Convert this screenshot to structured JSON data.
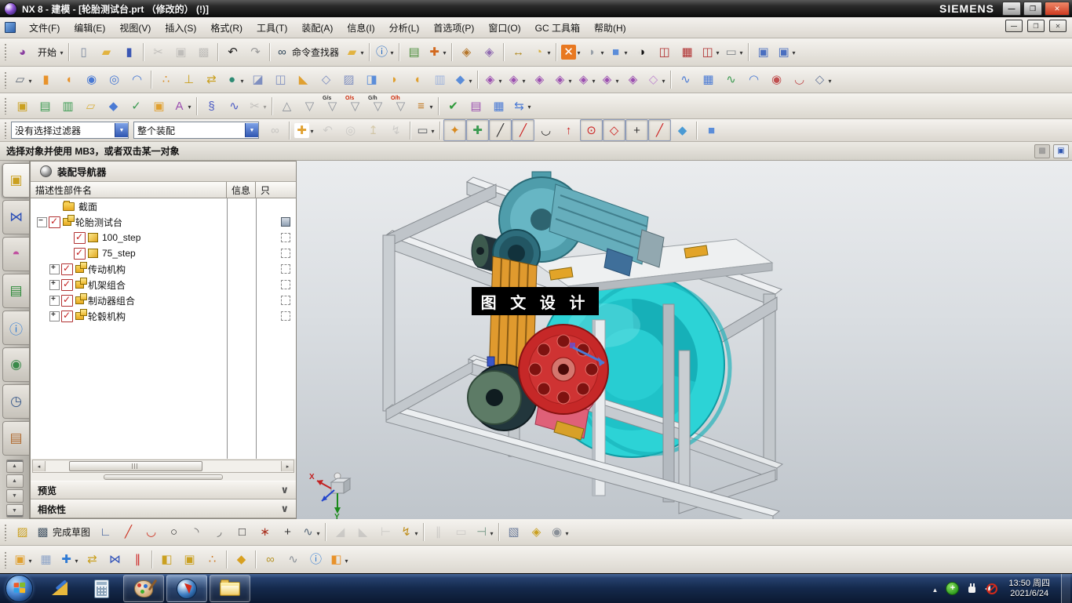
{
  "window": {
    "title": "NX 8 - 建模 - [轮胎测试台.prt （修改的）  (!)]",
    "brand": "SIEMENS"
  },
  "colors": {
    "taskbar_blue": "#15284d",
    "tire_cyan": "#2cd3d6",
    "disc_red": "#c62828",
    "belt_orange": "#e09a2e",
    "motor_teal": "#5fa8ba",
    "frame_gray": "#c9ced2",
    "watermark_bg": "#000000",
    "check_red": "#c41f1f"
  },
  "menu": {
    "items": [
      {
        "n": "menu-file",
        "label": "文件(F)"
      },
      {
        "n": "menu-edit",
        "label": "编辑(E)"
      },
      {
        "n": "menu-view",
        "label": "视图(V)"
      },
      {
        "n": "menu-insert",
        "label": "插入(S)"
      },
      {
        "n": "menu-format",
        "label": "格式(R)"
      },
      {
        "n": "menu-tools",
        "label": "工具(T)"
      },
      {
        "n": "menu-assemblies",
        "label": "装配(A)"
      },
      {
        "n": "menu-information",
        "label": "信息(I)"
      },
      {
        "n": "menu-analysis",
        "label": "分析(L)"
      },
      {
        "n": "menu-preferences",
        "label": "首选项(P)"
      },
      {
        "n": "menu-window",
        "label": "窗口(O)"
      },
      {
        "n": "menu-gc-toolbox",
        "label": "GC 工具箱"
      },
      {
        "n": "menu-help",
        "label": "帮助(H)"
      }
    ]
  },
  "toolbars": {
    "row1": [
      {
        "n": "nx-logo-icon",
        "g": "◕",
        "c": "#8a3fa0"
      },
      {
        "n": "start-menu-button",
        "label": "开始",
        "dd": 1
      },
      {
        "sep": 1
      },
      {
        "n": "new-file-button",
        "g": "▯",
        "c": "#7d8aa0"
      },
      {
        "n": "open-file-button",
        "g": "▰",
        "c": "#e2b340"
      },
      {
        "n": "save-button",
        "g": "▮",
        "c": "#3b57b4"
      },
      {
        "sep": 1
      },
      {
        "n": "cut-button",
        "g": "✂",
        "c": "#8a8a8a",
        "dis": 1
      },
      {
        "n": "copy-button",
        "g": "▣",
        "c": "#8a8a8a",
        "dis": 1
      },
      {
        "n": "paste-button",
        "g": "▩",
        "c": "#8a8a8a",
        "dis": 1
      },
      {
        "sep": 1
      },
      {
        "n": "undo-button",
        "g": "↶",
        "c": "#1c1c1c"
      },
      {
        "n": "redo-button",
        "g": "↷",
        "c": "#9a9a9a"
      },
      {
        "sep": 1
      },
      {
        "n": "command-finder-button",
        "g": "∞",
        "c": "#30475a",
        "label": "命令查找器"
      },
      {
        "n": "recent-files-button",
        "g": "▰",
        "c": "#e2b340",
        "dd": 1
      },
      {
        "sep": 1
      },
      {
        "n": "help-info-button",
        "g": "ⓘ",
        "c": "#1f66c0",
        "dd": 1
      },
      {
        "sep": 1
      },
      {
        "n": "object-info-button",
        "g": "▤",
        "c": "#4d8f3c"
      },
      {
        "n": "wcs-dynamics-button",
        "g": "✚",
        "c": "#d2691e",
        "dd": 1
      },
      {
        "sep": 1
      },
      {
        "n": "snapshot-button",
        "g": "◈",
        "c": "#b5762a"
      },
      {
        "n": "role-button",
        "g": "◈",
        "c": "#8f6ab0"
      },
      {
        "sep": 1
      },
      {
        "n": "measure-distance-button",
        "g": "↔",
        "c": "#b08a20"
      },
      {
        "n": "measure-angle-button",
        "g": "◔",
        "c": "#d8b040",
        "dd": 1
      },
      {
        "sep": 1
      },
      {
        "n": "close-window-button",
        "g": "✕",
        "c": "#ffffff",
        "b": "#e87820",
        "dd": 1
      },
      {
        "n": "display-part-button",
        "g": "◗",
        "c": "#98a0a8",
        "dd": 1
      },
      {
        "n": "shaded-display-button",
        "g": "■",
        "c": "#5b8dd9",
        "dd": 1
      },
      {
        "n": "render-style-button",
        "g": "◑",
        "c": "#111111"
      },
      {
        "n": "fix-display-1-button",
        "g": "◫",
        "c": "#b03030"
      },
      {
        "n": "fix-display-2-button",
        "g": "▦",
        "c": "#b03030"
      },
      {
        "n": "fix-display-3-button",
        "g": "◫",
        "c": "#b03030",
        "dd": 1
      },
      {
        "n": "background-color-button",
        "g": "▭",
        "c": "#80858a",
        "dd": 1
      },
      {
        "sep": 1
      },
      {
        "n": "window-cascade-button",
        "g": "▣",
        "c": "#4a6fc0"
      },
      {
        "n": "window-split-button",
        "g": "▣",
        "c": "#4a6fc0",
        "dd": 1
      }
    ],
    "row2": [
      {
        "n": "sketch-button",
        "g": "▱",
        "c": "#606a78",
        "dd": 1
      },
      {
        "n": "extrude-button",
        "g": "▮",
        "c": "#e8922a"
      },
      {
        "n": "revolve-button",
        "g": "◖",
        "c": "#e8922a"
      },
      {
        "n": "hole-button",
        "g": "◉",
        "c": "#4a7ad4"
      },
      {
        "n": "boss-button",
        "g": "◎",
        "c": "#4a7ad4"
      },
      {
        "n": "draft-button",
        "g": "◠",
        "c": "#4a7ad4"
      },
      {
        "sep": 1
      },
      {
        "n": "pattern-feature-button",
        "g": "∴",
        "c": "#d88a20"
      },
      {
        "n": "datum-plane-button",
        "g": "⊥",
        "c": "#caa020"
      },
      {
        "n": "move-object-button",
        "g": "⇄",
        "c": "#caa020"
      },
      {
        "n": "unite-button",
        "g": "●",
        "c": "#2e8b74",
        "dd": 1
      },
      {
        "n": "trim-body-button",
        "g": "◪",
        "c": "#7f8fc0"
      },
      {
        "n": "split-body-button",
        "g": "◫",
        "c": "#7f8fc0"
      },
      {
        "n": "bend-button",
        "g": "◣",
        "c": "#e0a030"
      },
      {
        "n": "sew-button",
        "g": "◇",
        "c": "#7f8fc0"
      },
      {
        "n": "patch-button",
        "g": "▨",
        "c": "#7f8fc0"
      },
      {
        "n": "offset-face-button",
        "g": "◨",
        "c": "#5b8dd9"
      },
      {
        "n": "flange-button",
        "g": "◗",
        "c": "#e0a030"
      },
      {
        "n": "contour-flange-button",
        "g": "◖",
        "c": "#e0a030"
      },
      {
        "n": "sheet-body-button",
        "g": "▥",
        "c": "#9fb4dc"
      },
      {
        "n": "polyhedron-button",
        "g": "◆",
        "c": "#5b8dd9",
        "dd": 1
      },
      {
        "sep": 1
      },
      {
        "n": "sm-move-face-button",
        "g": "◈",
        "c": "#9b4fb0",
        "dd": 1
      },
      {
        "n": "sm-pull-face-button",
        "g": "◈",
        "c": "#9b4fb0",
        "dd": 1
      },
      {
        "n": "sm-delete-face-button",
        "g": "◈",
        "c": "#9b4fb0"
      },
      {
        "n": "sm-copy-face-button",
        "g": "◈",
        "c": "#9b4fb0",
        "dd": 1
      },
      {
        "n": "sm-shell-button",
        "g": "◈",
        "c": "#9b4fb0",
        "dd": 1
      },
      {
        "n": "sm-resize-face-button",
        "g": "◈",
        "c": "#9b4fb0",
        "dd": 1
      },
      {
        "n": "sm-pattern-face-button",
        "g": "◈",
        "c": "#9b4fb0"
      },
      {
        "n": "sm-edge-blend-button",
        "g": "◇",
        "c": "#c08ad0",
        "dd": 1
      },
      {
        "sep": 1
      },
      {
        "n": "through-curves-button",
        "g": "∿",
        "c": "#4a7ad4"
      },
      {
        "n": "curve-mesh-button",
        "g": "▦",
        "c": "#4a7ad4"
      },
      {
        "n": "studio-surface-button",
        "g": "∿",
        "c": "#3a9a50"
      },
      {
        "n": "swept-button",
        "g": "◠",
        "c": "#4a7ad4"
      },
      {
        "n": "n-sided-surface-button",
        "g": "◉",
        "c": "#c05050"
      },
      {
        "n": "bridge-surface-button",
        "g": "◡",
        "c": "#c05050"
      },
      {
        "n": "more-surface-button",
        "g": "◇",
        "c": "#6a7a9a",
        "dd": 1
      }
    ],
    "row3": [
      {
        "n": "task-sketch-button",
        "g": "▣",
        "c": "#caa020"
      },
      {
        "n": "layer-settings-button",
        "g": "▤",
        "c": "#3a9a50"
      },
      {
        "n": "view-in-layer-button",
        "g": "▥",
        "c": "#3a9a50"
      },
      {
        "n": "annotation-button",
        "g": "▱",
        "c": "#d8b040"
      },
      {
        "n": "interference-check-button",
        "g": "◆",
        "c": "#4a7ad4"
      },
      {
        "n": "clamp-check-button",
        "g": "✓",
        "c": "#3a9a50"
      },
      {
        "n": "export-check-button",
        "g": "▣",
        "c": "#e0a030"
      },
      {
        "n": "text-button",
        "g": "A",
        "c": "#9b4fb0",
        "dd": 1
      },
      {
        "sep": 1
      },
      {
        "n": "spring-design-button",
        "g": "§",
        "c": "#4a5ac4"
      },
      {
        "n": "spring-stretch-button",
        "g": "∿",
        "c": "#4a5ac4"
      },
      {
        "n": "spring-cut-button",
        "g": "✂",
        "c": "#8a8a8a",
        "dis": 1,
        "dd": 1
      },
      {
        "sep": 1
      },
      {
        "n": "weld-point-button",
        "g": "△",
        "c": "#8a9098"
      },
      {
        "n": "weld-groove-button",
        "g": "▽",
        "c": "#8a9098"
      },
      {
        "n": "weld-gs-button",
        "g": "▽",
        "c": "#8a9098",
        "tag": "G/s",
        "tagc": "#333333"
      },
      {
        "n": "weld-os-button",
        "g": "▽",
        "c": "#8a9098",
        "tag": "O/s",
        "tagc": "#cc2200"
      },
      {
        "n": "weld-gh-button",
        "g": "▽",
        "c": "#8a9098",
        "tag": "G/h",
        "tagc": "#333333"
      },
      {
        "n": "weld-oh-button",
        "g": "▽",
        "c": "#8a9098",
        "tag": "O/h",
        "tagc": "#cc2200"
      },
      {
        "n": "weld-list-button",
        "g": "≡",
        "c": "#c07820",
        "dd": 1
      },
      {
        "sep": 1
      },
      {
        "n": "requirement-verify-button",
        "g": "✔",
        "c": "#2e9a3a"
      },
      {
        "n": "hd3d-check-button",
        "g": "▤",
        "c": "#9b4fb0"
      },
      {
        "n": "part-table-button",
        "g": "▦",
        "c": "#4a7ad4"
      },
      {
        "n": "model-compare-button",
        "g": "⇆",
        "c": "#4a7ad4",
        "dd": 1
      }
    ],
    "filters": {
      "selection_filter": "没有选择过滤器",
      "scope_filter": "整个装配"
    },
    "row4_icons": [
      {
        "n": "filter-find-button",
        "g": "∞",
        "c": "#9a9a9a",
        "dis": 1
      },
      {
        "sep": 1
      },
      {
        "n": "select-priority-button",
        "g": "✚",
        "c": "#e0a030",
        "b": "#ffffff",
        "dd": 1
      },
      {
        "n": "undo-selection-button",
        "g": "↶",
        "c": "#a8a8a8",
        "dis": 1
      },
      {
        "n": "deselect-all-button",
        "g": "◎",
        "c": "#a8a8a8",
        "dis": 1
      },
      {
        "n": "select-up-button",
        "g": "↥",
        "c": "#b8a060",
        "dis": 1
      },
      {
        "n": "select-drag-button",
        "g": "↯",
        "c": "#a8a8a8",
        "dis": 1
      },
      {
        "sep": 1
      },
      {
        "n": "marquee-select-button",
        "g": "▭",
        "c": "#55595e",
        "dd": 1
      },
      {
        "sep": 1
      },
      {
        "n": "snap-point-toggle",
        "g": "✦",
        "c": "#d88a20",
        "pressed": 1
      },
      {
        "n": "snap-multi-toggle",
        "g": "✚",
        "c": "#3a9a50",
        "pressed": 1
      },
      {
        "n": "snap-endpoint-toggle",
        "g": "╱",
        "c": "#333333",
        "pressed": 1
      },
      {
        "n": "snap-midpoint-toggle",
        "g": "╱",
        "c": "#cc2222",
        "pressed": 1
      },
      {
        "n": "snap-arc-toggle",
        "g": "◡",
        "c": "#333333"
      },
      {
        "n": "snap-spike-toggle",
        "g": "↑",
        "c": "#cc2222"
      },
      {
        "n": "snap-center-toggle",
        "g": "⊙",
        "c": "#cc2222",
        "pressed": 1
      },
      {
        "n": "snap-quadrant-toggle",
        "g": "◇",
        "c": "#cc2222",
        "pressed": 1
      },
      {
        "n": "snap-intersection-toggle",
        "g": "+",
        "c": "#333333",
        "pressed": 1
      },
      {
        "n": "snap-point-on-curve-toggle",
        "g": "╱",
        "c": "#cc2222",
        "pressed": 1
      },
      {
        "n": "snap-face-toggle",
        "g": "◆",
        "c": "#4a9ad4"
      },
      {
        "sep": 1
      },
      {
        "n": "snap-solid-toggle",
        "g": "■",
        "c": "#5b8dd9"
      }
    ],
    "sketch": [
      {
        "n": "sketch-env-button",
        "g": "▨",
        "c": "#caa020"
      },
      {
        "n": "finish-sketch-button",
        "g": "▩",
        "c": "#4a5a6a",
        "label": "完成草图"
      },
      {
        "n": "profile-button",
        "g": "∟",
        "c": "#3a5a9a"
      },
      {
        "n": "line-button",
        "g": "╱",
        "c": "#cc3322"
      },
      {
        "n": "arc-button",
        "g": "◡",
        "c": "#cc3322"
      },
      {
        "n": "circle-button",
        "g": "○",
        "c": "#333333"
      },
      {
        "n": "fillet-button",
        "g": "◝",
        "c": "#666666"
      },
      {
        "n": "chamfer-button",
        "g": "◞",
        "c": "#666666"
      },
      {
        "n": "rectangle-button",
        "g": "□",
        "c": "#333333"
      },
      {
        "n": "polygon-button",
        "g": "∗",
        "c": "#aa3322"
      },
      {
        "n": "point-button",
        "g": "+",
        "c": "#333333"
      },
      {
        "n": "studio-spline-button",
        "g": "∿",
        "c": "#556677",
        "dd": 1
      },
      {
        "sep": 1
      },
      {
        "n": "quick-trim-button",
        "g": "◢",
        "c": "#a8a8a8",
        "dis": 1
      },
      {
        "n": "quick-extend-button",
        "g": "◣",
        "c": "#a8a8a8",
        "dis": 1
      },
      {
        "n": "make-corner-button",
        "g": "⊢",
        "c": "#a8a8a8",
        "dis": 1
      },
      {
        "n": "constraints-button",
        "g": "↯",
        "c": "#c09020",
        "dd": 1
      },
      {
        "sep": 1
      },
      {
        "n": "auto-constrain-button",
        "g": "∥",
        "c": "#a8a8a8",
        "dis": 1
      },
      {
        "n": "dimension-button",
        "g": "▭",
        "c": "#a8a8a8",
        "dis": 1
      },
      {
        "n": "show-constraints-button",
        "g": "⊣",
        "c": "#7a9a8a",
        "dd": 1
      },
      {
        "sep": 1
      },
      {
        "n": "convert-reference-button",
        "g": "▧",
        "c": "#6a7a9a"
      },
      {
        "n": "alternate-solution-button",
        "g": "◈",
        "c": "#caa020"
      },
      {
        "n": "inferred-dimensions-button",
        "g": "◉",
        "c": "#8a9098",
        "dd": 1
      }
    ],
    "assembly": [
      {
        "n": "find-component-button",
        "g": "▣",
        "c": "#e0a030",
        "dd": 1
      },
      {
        "n": "open-by-proximity-button",
        "g": "▦",
        "c": "#8fa5c8"
      },
      {
        "n": "add-component-button",
        "g": "✚",
        "c": "#2e7ad4",
        "dd": 1
      },
      {
        "n": "move-component-button",
        "g": "⇄",
        "c": "#caa020"
      },
      {
        "n": "assembly-constraints-button",
        "g": "⋈",
        "c": "#2e50b8"
      },
      {
        "n": "show-dof-button",
        "g": "∥",
        "c": "#cc2222"
      },
      {
        "sep": 1
      },
      {
        "n": "mirror-assembly-button",
        "g": "◧",
        "c": "#caa020"
      },
      {
        "n": "suppress-component-button",
        "g": "▣",
        "c": "#caa020"
      },
      {
        "n": "pattern-component-button",
        "g": "∴",
        "c": "#cc7722"
      },
      {
        "sep": 1
      },
      {
        "n": "wave-mode-button",
        "g": "◆",
        "c": "#d8a020"
      },
      {
        "sep": 1
      },
      {
        "n": "wave-geometry-link-button",
        "g": "∞",
        "c": "#b8962a"
      },
      {
        "n": "pipe-link-button",
        "g": "∿",
        "c": "#8a9098"
      },
      {
        "n": "relations-browser-button",
        "g": "ⓘ",
        "c": "#2e7ad4"
      },
      {
        "n": "exploded-view-button",
        "g": "◧",
        "c": "#e8922a",
        "dd": 1
      }
    ]
  },
  "prompt": {
    "text": "选择对象并使用 MB3，或者双击某一对象"
  },
  "resource_bar": {
    "tabs": [
      {
        "n": "tab-assembly-navigator",
        "g": "▣",
        "c": "#caa020",
        "active": 1
      },
      {
        "n": "tab-constraint-navigator",
        "g": "⋈",
        "c": "#2e50b8"
      },
      {
        "n": "tab-part-navigator",
        "g": "◓",
        "c": "#c050a0"
      },
      {
        "n": "tab-reuse-library",
        "g": "▤",
        "c": "#2e8b3a"
      },
      {
        "n": "tab-hd3d-tools",
        "g": "ⓘ",
        "c": "#2e7ad4"
      },
      {
        "n": "tab-web-browser",
        "g": "◉",
        "c": "#3a8a4a"
      },
      {
        "n": "tab-history",
        "g": "◷",
        "c": "#3a5a8a"
      },
      {
        "n": "tab-system-materials",
        "g": "▤",
        "c": "#b06a30"
      }
    ],
    "scrolls": [
      {
        "n": "resource-scroll-top",
        "g": "▲",
        "bartop": 1
      },
      {
        "n": "resource-scroll-up",
        "g": "▲"
      },
      {
        "n": "resource-scroll-down",
        "g": "▼"
      },
      {
        "n": "resource-scroll-bottom",
        "g": "▼",
        "barbottom": 1
      }
    ]
  },
  "navigator": {
    "title": "装配导航器",
    "columns": [
      {
        "label": "描述性部件名"
      },
      {
        "label": "信息"
      },
      {
        "label": "只"
      }
    ],
    "rows": [
      {
        "n": "tree-item-section",
        "label": "截面",
        "pad": "26px",
        "icoFolder": 1
      },
      {
        "n": "tree-item-tire-test-rig",
        "label": "轮胎测试台",
        "pad": "8px",
        "exMinus": 1,
        "check": 1,
        "icoAsm": 1,
        "infoSave": 1
      },
      {
        "n": "tree-item-100-step",
        "label": "100_step",
        "pad": "40px",
        "check": 1,
        "icoPart": 1,
        "infoDash": 1
      },
      {
        "n": "tree-item-75-step",
        "label": "75_step",
        "pad": "40px",
        "check": 1,
        "icoPart": 1,
        "infoDash": 1
      },
      {
        "n": "tree-item-drive-mechanism",
        "label": "传动机构",
        "pad": "24px",
        "exPlus": 1,
        "check": 1,
        "icoAsm": 1,
        "infoDash": 1
      },
      {
        "n": "tree-item-frame-assembly",
        "label": "机架组合",
        "pad": "24px",
        "exPlus": 1,
        "check": 1,
        "icoAsm": 1,
        "infoDash": 1
      },
      {
        "n": "tree-item-brake-assembly",
        "label": "制动器组合",
        "pad": "24px",
        "exPlus": 1,
        "check": 1,
        "icoAsm": 1,
        "infoDash": 1
      },
      {
        "n": "tree-item-hub-mechanism",
        "label": "轮毂机构",
        "pad": "24px",
        "exPlus": 1,
        "check": 1,
        "icoAsm": 1,
        "infoDash": 1
      }
    ],
    "panels": [
      {
        "n": "preview-panel-header",
        "label": "预览"
      },
      {
        "n": "dependencies-panel-header",
        "label": "相依性"
      }
    ]
  },
  "viewport": {
    "watermark": "图 文 设 计",
    "triad": {
      "x": "X",
      "y": "Y"
    }
  },
  "taskbar": {
    "clock": {
      "time": "13:50 周四",
      "date": "2021/6/24"
    }
  }
}
